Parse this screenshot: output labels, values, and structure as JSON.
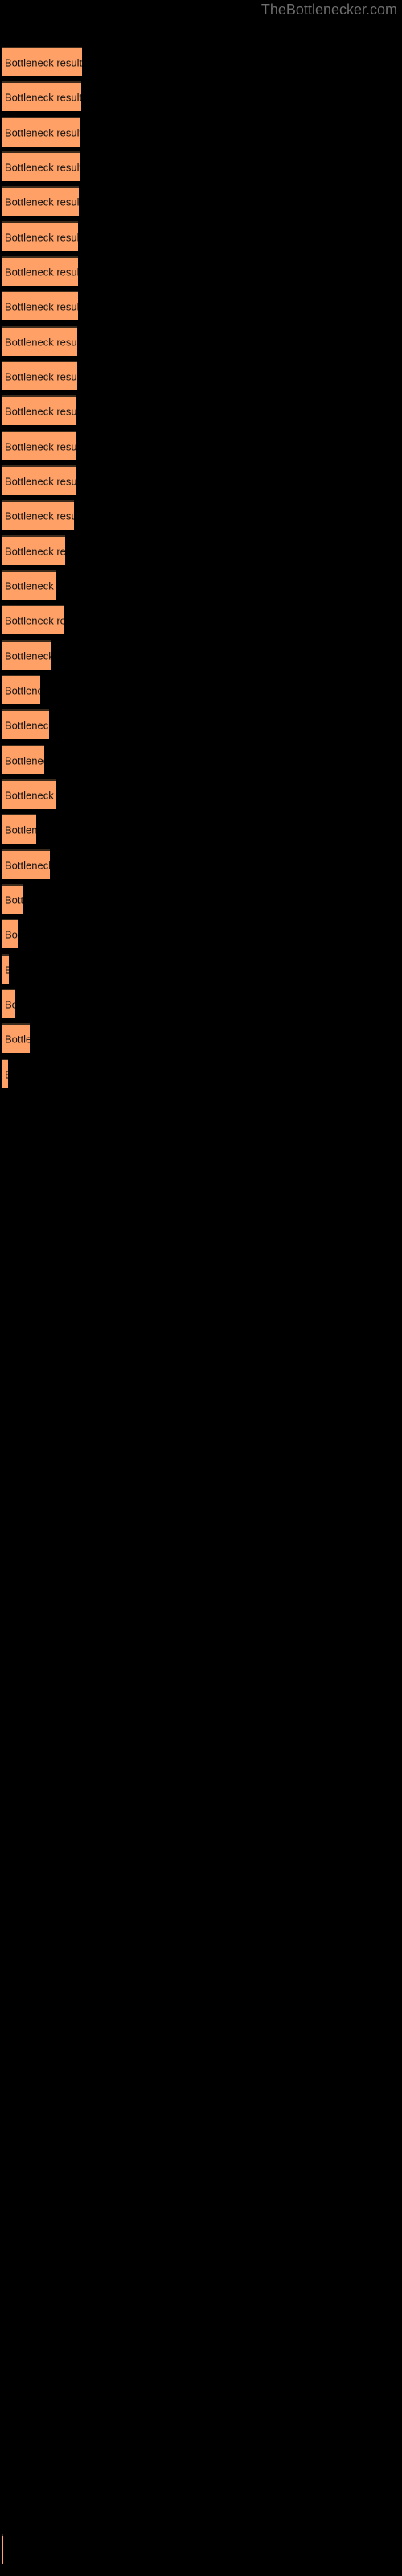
{
  "header": {
    "site_title": "TheBottlenecker.com",
    "title_color": "#6e6e6e"
  },
  "colors": {
    "background": "#000000",
    "bar_fill": "#ffa167",
    "bar_border_top": "#3a2a1c",
    "label_text": "#101010"
  },
  "chart_data": {
    "type": "bar",
    "orientation": "horizontal",
    "title": "",
    "subtitle": "",
    "xlabel": "",
    "ylabel": "",
    "grid": false,
    "legend": null,
    "bar_label_text": "Bottleneck result",
    "categories": [
      "Bottleneck result",
      "Bottleneck result",
      "Bottleneck result",
      "Bottleneck result",
      "Bottleneck result",
      "Bottleneck result",
      "Bottleneck result",
      "Bottleneck result",
      "Bottleneck result",
      "Bottleneck result",
      "Bottleneck result",
      "Bottleneck result",
      "Bottleneck result",
      "Bottleneck result",
      "Bottleneck result",
      "Bottleneck result",
      "Bottleneck result",
      "Bottleneck result",
      "Bottleneck result",
      "Bottleneck result",
      "Bottleneck result",
      "Bottleneck result",
      "Bottleneck result",
      "Bottleneck result",
      "Bottleneck result",
      "Bottleneck result",
      "Bottleneck result",
      "Bottleneck result",
      "Bottleneck result",
      "Bottleneck result",
      "Bottleneck result",
      "Bottleneck result"
    ],
    "values": [
      100,
      99,
      98,
      97,
      96,
      95,
      95,
      94,
      93,
      92,
      92,
      89,
      91,
      89,
      86,
      73,
      88,
      71,
      56,
      67,
      61,
      79,
      48,
      69,
      33,
      25,
      10,
      19,
      40,
      9,
      2,
      2
    ],
    "xlim": [
      0,
      100
    ],
    "ylim": null
  },
  "bars": [
    {
      "label": "Bottleneck result",
      "top": 58,
      "width": 100
    },
    {
      "label": "Bottleneck result",
      "top": 101,
      "width": 99
    },
    {
      "label": "Bottleneck result",
      "top": 145,
      "width": 98
    },
    {
      "label": "Bottleneck result",
      "top": 188,
      "width": 97
    },
    {
      "label": "Bottleneck result",
      "top": 231,
      "width": 96
    },
    {
      "label": "Bottleneck result",
      "top": 275,
      "width": 95
    },
    {
      "label": "Bottleneck result",
      "top": 318,
      "width": 95
    },
    {
      "label": "Bottleneck result",
      "top": 361,
      "width": 95
    },
    {
      "label": "Bottleneck result",
      "top": 405,
      "width": 94
    },
    {
      "label": "Bottleneck result",
      "top": 448,
      "width": 94
    },
    {
      "label": "Bottleneck result",
      "top": 491,
      "width": 93
    },
    {
      "label": "Bottleneck result",
      "top": 535,
      "width": 92
    },
    {
      "label": "Bottleneck result",
      "top": 578,
      "width": 92
    },
    {
      "label": "Bottleneck result",
      "top": 621,
      "width": 90
    },
    {
      "label": "Bottleneck result",
      "top": 665,
      "width": 79
    },
    {
      "label": "Bottleneck result",
      "top": 708,
      "width": 68
    },
    {
      "label": "Bottleneck result",
      "top": 751,
      "width": 78
    },
    {
      "label": "Bottleneck result",
      "top": 795,
      "width": 62
    },
    {
      "label": "Bottleneck result",
      "top": 838,
      "width": 48
    },
    {
      "label": "Bottleneck result",
      "top": 881,
      "width": 59
    },
    {
      "label": "Bottleneck result",
      "top": 925,
      "width": 53
    },
    {
      "label": "Bottleneck result",
      "top": 968,
      "width": 68
    },
    {
      "label": "Bottleneck result",
      "top": 1011,
      "width": 43
    },
    {
      "label": "Bottleneck result",
      "top": 1055,
      "width": 60
    },
    {
      "label": "Bottleneck result",
      "top": 1098,
      "width": 27
    },
    {
      "label": "Bottleneck result",
      "top": 1141,
      "width": 21
    },
    {
      "label": "Bottleneck result",
      "top": 1185,
      "width": 9
    },
    {
      "label": "Bottleneck result",
      "top": 1228,
      "width": 17
    },
    {
      "label": "Bottleneck result",
      "top": 1271,
      "width": 35
    },
    {
      "label": "Bottleneck result",
      "top": 1315,
      "width": 8
    },
    {
      "label": "Bottleneck result",
      "top": 3148,
      "width": 2
    }
  ]
}
